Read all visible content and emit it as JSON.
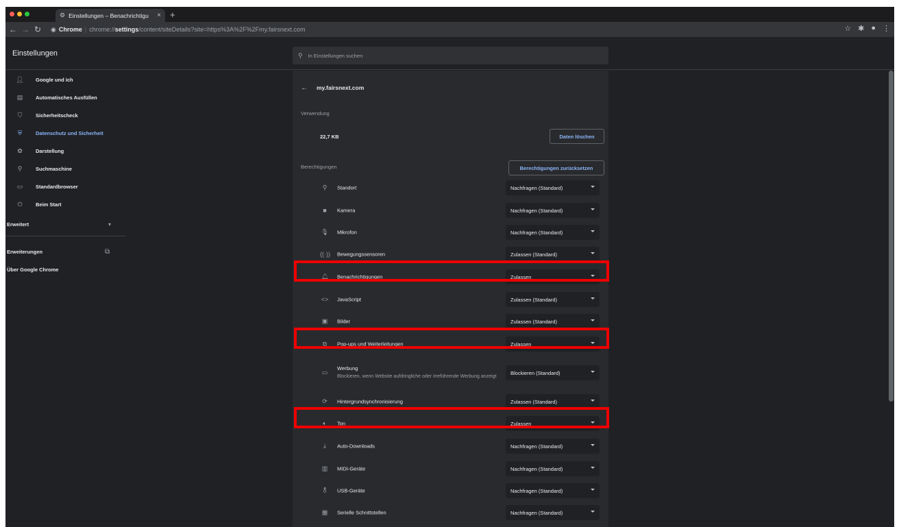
{
  "colors": {
    "bg": "#202124",
    "card": "#292a2d",
    "accent": "#8ab4f8",
    "highlight": "#ee0000"
  },
  "browser": {
    "tab_title": "Einstellungen – Benachrichtigu",
    "chrome_label": "Chrome",
    "url_prefix": "chrome://",
    "url_bold": "settings",
    "url_rest": "/content/siteDetails?site=https%3A%2F%2Fmy.fairsnext.com"
  },
  "header": {
    "title": "Einstellungen",
    "search_placeholder": "In Einstellungen suchen"
  },
  "sidebar": {
    "items": [
      {
        "label": "Google und ich",
        "icon": "person-icon"
      },
      {
        "label": "Automatisches Ausfüllen",
        "icon": "clipboard-icon"
      },
      {
        "label": "Sicherheitscheck",
        "icon": "shield-check-icon"
      },
      {
        "label": "Datenschutz und Sicherheit",
        "icon": "shield-icon",
        "active": true
      },
      {
        "label": "Darstellung",
        "icon": "palette-icon"
      },
      {
        "label": "Suchmaschine",
        "icon": "search-icon"
      },
      {
        "label": "Standardbrowser",
        "icon": "browser-icon"
      },
      {
        "label": "Beim Start",
        "icon": "power-icon"
      }
    ],
    "advanced": "Erweitert",
    "extensions": "Erweiterungen",
    "about": "Über Google Chrome"
  },
  "site": {
    "name": "my.fairsnext.com",
    "usage_heading": "Verwendung",
    "usage_value": "22,7 KB",
    "clear_button": "Daten löschen",
    "permissions_heading": "Berechtigungen",
    "reset_button": "Berechtigungen zurücksetzen"
  },
  "permissions": [
    {
      "label": "Standort",
      "value": "Nachfragen (Standard)",
      "icon": "location-icon"
    },
    {
      "label": "Kamera",
      "value": "Nachfragen (Standard)",
      "icon": "camera-icon"
    },
    {
      "label": "Mikrofon",
      "value": "Nachfragen (Standard)",
      "icon": "microphone-icon"
    },
    {
      "label": "Bewegungssensoren",
      "value": "Zulassen (Standard)",
      "icon": "sensors-icon"
    },
    {
      "label": "Benachrichtigungen",
      "value": "Zulassen",
      "icon": "bell-icon",
      "highlighted": true
    },
    {
      "label": "JavaScript",
      "value": "Zulassen (Standard)",
      "icon": "code-icon"
    },
    {
      "label": "Bilder",
      "value": "Zulassen (Standard)",
      "icon": "image-icon"
    },
    {
      "label": "Pop-ups und Weiterleitungen",
      "value": "Zulassen",
      "icon": "popup-icon",
      "highlighted": true
    },
    {
      "label": "Werbung",
      "sublabel": "Blockieren, wenn Website aufdringliche oder irreführende Werbung anzeigt",
      "value": "Blockieren (Standard)",
      "icon": "ad-icon"
    },
    {
      "label": "Hintergrundsynchronisierung",
      "value": "Zulassen (Standard)",
      "icon": "sync-icon"
    },
    {
      "label": "Ton",
      "value": "Zulassen",
      "icon": "speaker-icon",
      "highlighted": true
    },
    {
      "label": "Auto-Downloads",
      "value": "Nachfragen (Standard)",
      "icon": "download-icon"
    },
    {
      "label": "MIDI-Geräte",
      "value": "Nachfragen (Standard)",
      "icon": "midi-icon"
    },
    {
      "label": "USB-Geräte",
      "value": "Nachfragen (Standard)",
      "icon": "usb-icon"
    },
    {
      "label": "Serielle Schnittstellen",
      "value": "Nachfragen (Standard)",
      "icon": "serial-port-icon"
    }
  ]
}
